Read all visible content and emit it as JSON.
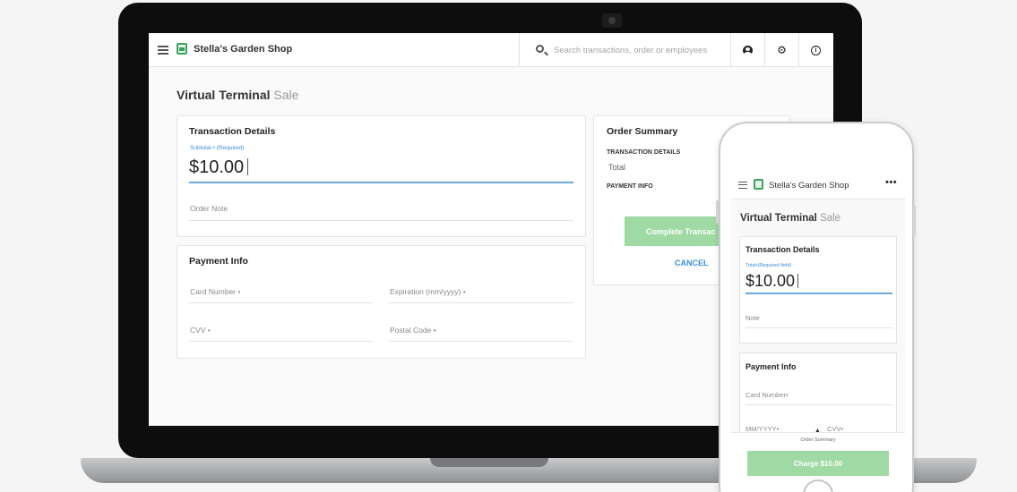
{
  "app": {
    "store_name": "Stella's Garden Shop"
  },
  "desktop": {
    "search": {
      "placeholder": "Search transactions, order or employees"
    },
    "toolbar_icons": [
      "user-icon",
      "gear-icon",
      "info-icon"
    ],
    "page_title": {
      "main": "Virtual Terminal",
      "sub": "Sale"
    },
    "transaction_details": {
      "heading": "Transaction Details",
      "subtotal_label": "Subtotal • (Required)",
      "amount": "$10.00",
      "order_note_label": "Order Note"
    },
    "payment_info": {
      "heading": "Payment Info",
      "card_number_label": "Card Number •",
      "expiration_label": "Expiration (mm/yyyy) •",
      "cvv_label": "CVV •",
      "postal_code_label": "Postal Code •"
    },
    "order_summary": {
      "heading": "Order Summary",
      "transaction_details_label": "TRANSACTION DETAILS",
      "total_label": "Total",
      "payment_info_label": "PAYMENT INFO",
      "complete_button": "Complete Transac",
      "cancel_button": "CANCEL"
    }
  },
  "mobile": {
    "more_icon": "•••",
    "page_title": {
      "main": "Virtual Terminal",
      "sub": "Sale"
    },
    "transaction_details": {
      "heading": "Transaction Details",
      "total_label": "Total•(Required field)",
      "amount": "$10.00",
      "note_label": "Note"
    },
    "payment_info": {
      "heading": "Payment Info",
      "card_number_label": "Card Number•",
      "expiry_label": "MM/YYYY•",
      "cvv_label": "CVV•"
    },
    "order_summary_label": "Order Summary",
    "charge_button": "Charge $10.00"
  },
  "colors": {
    "accent_blue": "#3a8ed6",
    "brand_green": "#3aa35a",
    "button_green": "#9fd9a3"
  }
}
